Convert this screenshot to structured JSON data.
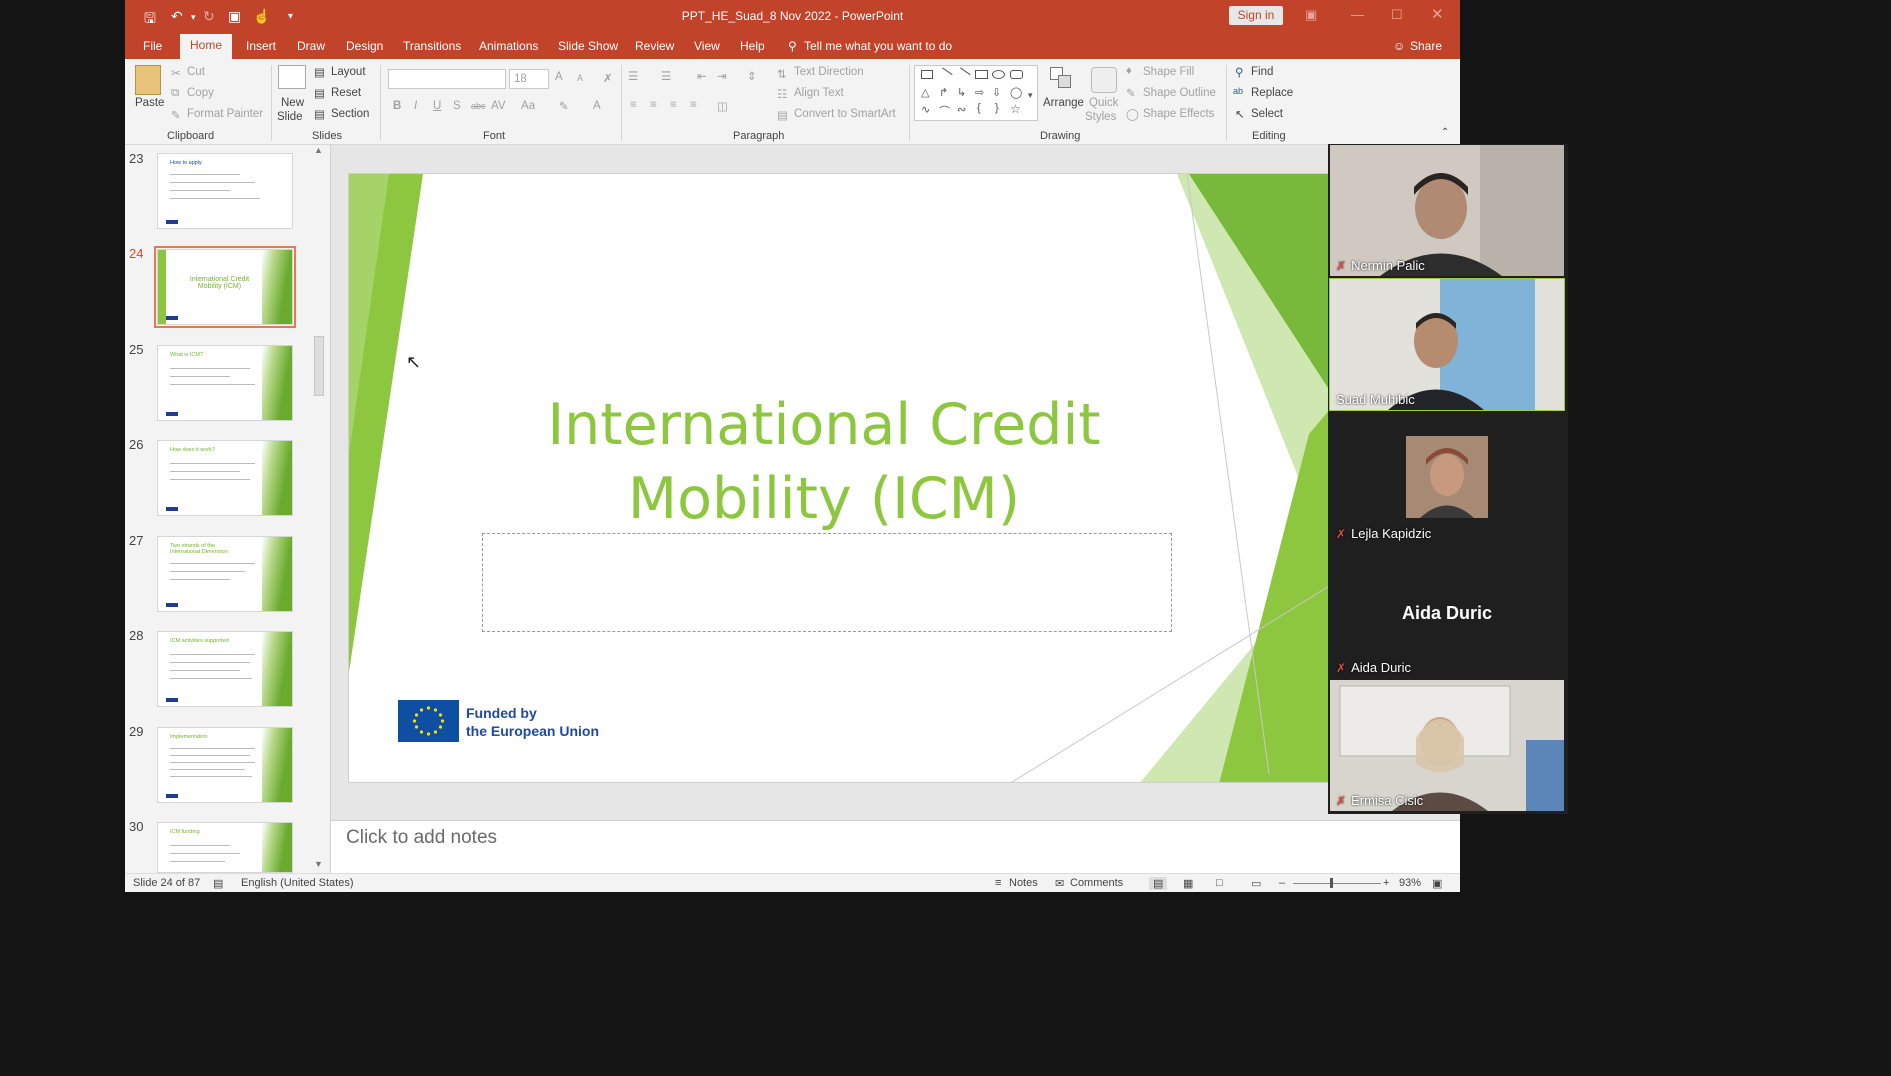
{
  "app": {
    "document_title": "PPT_HE_Suad_8 Nov 2022  -  PowerPoint",
    "sign_in": "Sign in"
  },
  "tabs": {
    "file": "File",
    "home": "Home",
    "insert": "Insert",
    "draw": "Draw",
    "design": "Design",
    "transitions": "Transitions",
    "animations": "Animations",
    "slide_show": "Slide Show",
    "review": "Review",
    "view": "View",
    "help": "Help",
    "tell_me": "Tell me what you want to do",
    "share": "Share"
  },
  "ribbon": {
    "clipboard": {
      "paste": "Paste",
      "cut": "Cut",
      "copy": "Copy",
      "format_painter": "Format Painter",
      "group": "Clipboard"
    },
    "slides": {
      "new_slide_line1": "New",
      "new_slide_line2": "Slide",
      "layout": "Layout",
      "reset": "Reset",
      "section": "Section",
      "group": "Slides"
    },
    "font": {
      "font_name": "",
      "font_size": "18",
      "bold": "B",
      "italic": "I",
      "underline": "U",
      "shadow": "S",
      "strike": "abc",
      "spacing": "AV",
      "case": "Aa",
      "color": "A",
      "grow": "A",
      "shrink": "A",
      "group": "Font"
    },
    "paragraph": {
      "text_direction": "Text Direction",
      "align_text": "Align Text",
      "convert_smartart": "Convert to SmartArt",
      "group": "Paragraph"
    },
    "drawing": {
      "arrange": "Arrange",
      "quick_styles_line1": "Quick",
      "quick_styles_line2": "Styles",
      "shape_fill": "Shape Fill",
      "shape_outline": "Shape Outline",
      "shape_effects": "Shape Effects",
      "group": "Drawing"
    },
    "editing": {
      "find": "Find",
      "replace": "Replace",
      "select": "Select",
      "group": "Editing"
    }
  },
  "thumbnails": [
    {
      "num": "23",
      "title": "How to apply",
      "selected": false
    },
    {
      "num": "24",
      "title": "International Credit Mobility (ICM)",
      "selected": true
    },
    {
      "num": "25",
      "title": "What is ICM?",
      "selected": false
    },
    {
      "num": "26",
      "title": "How does it work?",
      "selected": false
    },
    {
      "num": "27",
      "title": "Two strands of the International Dimension",
      "selected": false
    },
    {
      "num": "28",
      "title": "ICM activities supported",
      "selected": false
    },
    {
      "num": "29",
      "title": "Implementation",
      "selected": false
    },
    {
      "num": "30",
      "title": "ICM funding",
      "selected": false
    }
  ],
  "slide": {
    "title_line1": "International Credit",
    "title_line2": "Mobility (ICM)",
    "funded_line1": "Funded by",
    "funded_line2": "the European Union"
  },
  "notes_placeholder": "Click to add notes",
  "status": {
    "slide_position": "Slide 24 of 87",
    "language": "English (United States)",
    "notes": "Notes",
    "comments": "Comments",
    "zoom": "93%"
  },
  "participants": [
    {
      "name": "Nermin Palic",
      "muted": true,
      "video": true,
      "active": false
    },
    {
      "name": "Suad Muhibic",
      "muted": false,
      "video": true,
      "active": true
    },
    {
      "name": "Lejla Kapidzic",
      "muted": true,
      "video": true,
      "active": false
    },
    {
      "name": "Aida Duric",
      "muted": true,
      "video": false,
      "active": false
    },
    {
      "name": "Ermisa Cisic",
      "muted": true,
      "video": true,
      "active": false
    }
  ],
  "colors": {
    "accent": "#c0432a",
    "slide_title": "#8dc63f",
    "eu_blue": "#1e4aa1",
    "selected_outline": "#e8794e"
  }
}
